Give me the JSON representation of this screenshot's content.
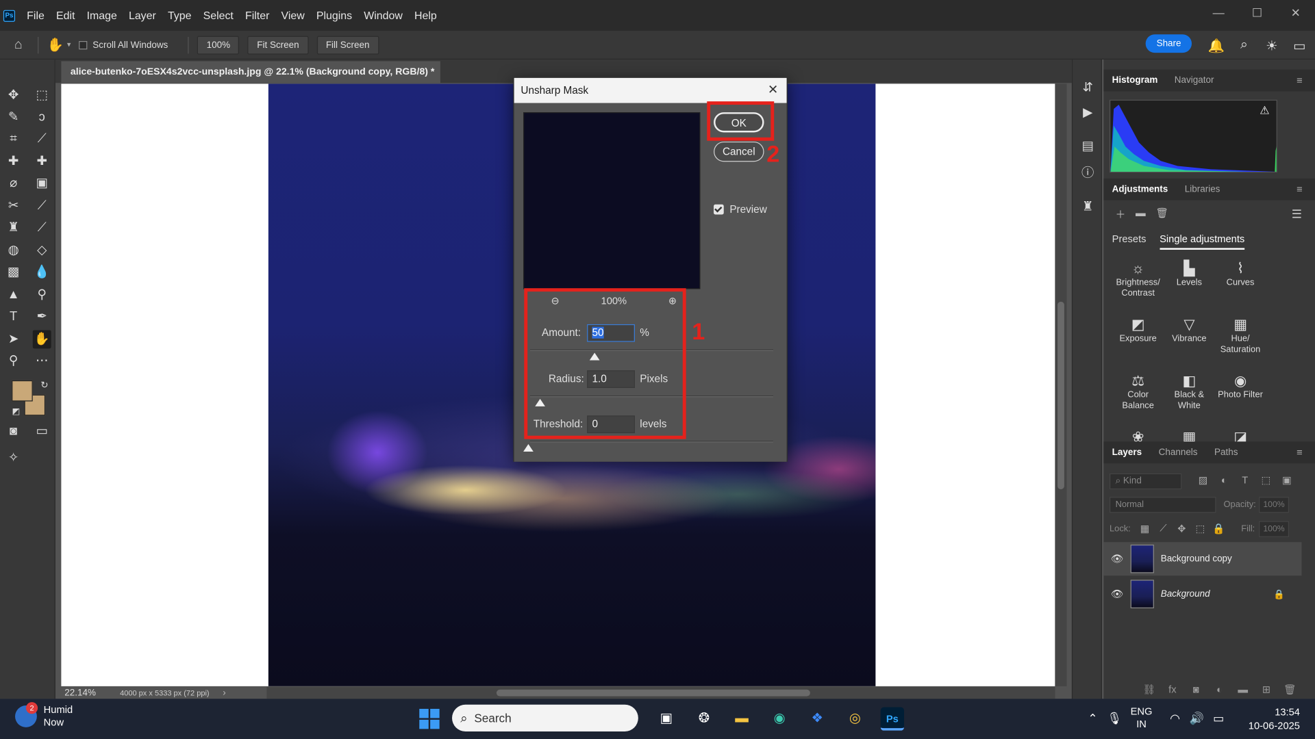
{
  "app": {
    "logo": "Ps",
    "menu": [
      "File",
      "Edit",
      "Image",
      "Layer",
      "Type",
      "Select",
      "Filter",
      "View",
      "Plugins",
      "Window",
      "Help"
    ],
    "window_controls": [
      "—",
      "☐",
      "✕"
    ]
  },
  "options_bar": {
    "scroll_all_windows": "Scroll All Windows",
    "zoom_btn": "100%",
    "fit_screen": "Fit Screen",
    "fill_screen": "Fill Screen",
    "share": "Share"
  },
  "document": {
    "tab_title": "alice-butenko-7oESX4s2vcc-unsplash.jpg @ 22.1% (Background copy, RGB/8) *",
    "tab_close": "×",
    "status_zoom": "22.14%",
    "status_dims": "4000 px x 5333 px (72 ppi)",
    "status_arrow": "›"
  },
  "colors": {
    "foreground": "#c9a878",
    "background": "#c9a878",
    "annotation": "#e5221c",
    "accent": "#1473e6"
  },
  "panels": {
    "top_tabs": [
      "Histogram",
      "Navigator"
    ],
    "adj_tabs": [
      "Adjustments",
      "Libraries"
    ],
    "adj_subtabs": [
      "Presets",
      "Single adjustments"
    ],
    "adjustments": [
      {
        "icon": "☼",
        "label": "Brightness/ Contrast"
      },
      {
        "icon": "▙",
        "label": "Levels"
      },
      {
        "icon": "⌇",
        "label": "Curves"
      },
      {
        "icon": "◩",
        "label": "Exposure"
      },
      {
        "icon": "▽",
        "label": "Vibrance"
      },
      {
        "icon": "▦",
        "label": "Hue/ Saturation"
      },
      {
        "icon": "⚖",
        "label": "Color Balance"
      },
      {
        "icon": "◧",
        "label": "Black & White"
      },
      {
        "icon": "◉",
        "label": "Photo Filter"
      },
      {
        "icon": "❀",
        "label": ""
      },
      {
        "icon": "▦",
        "label": ""
      },
      {
        "icon": "◪",
        "label": ""
      }
    ],
    "layer_tabs": [
      "Layers",
      "Channels",
      "Paths"
    ],
    "kind": "Kind",
    "blend_mode": "Normal",
    "opacity_label": "Opacity:",
    "opacity_value": "100%",
    "lock_label": "Lock:",
    "fill_label": "Fill:",
    "fill_value": "100%",
    "layers": [
      {
        "name": "Background copy",
        "selected": true,
        "locked": false
      },
      {
        "name": "Background",
        "selected": false,
        "locked": true
      }
    ]
  },
  "dialog": {
    "title": "Unsharp Mask",
    "close": "✕",
    "ok": "OK",
    "cancel": "Cancel",
    "preview_label": "Preview",
    "preview_checked": true,
    "zoom_level": "100%",
    "amount_label": "Amount:",
    "amount_value": "50",
    "amount_unit": "%",
    "radius_label": "Radius:",
    "radius_value": "1.0",
    "radius_unit": "Pixels",
    "threshold_label": "Threshold:",
    "threshold_value": "0",
    "threshold_unit": "levels",
    "annotation_1": "1",
    "annotation_2": "2"
  },
  "taskbar": {
    "weather_badge": "2",
    "weather_title": "Humid",
    "weather_sub": "Now",
    "search_placeholder": "Search",
    "lang_top": "ENG",
    "lang_bottom": "IN",
    "time": "13:54",
    "date": "10-06-2025"
  }
}
